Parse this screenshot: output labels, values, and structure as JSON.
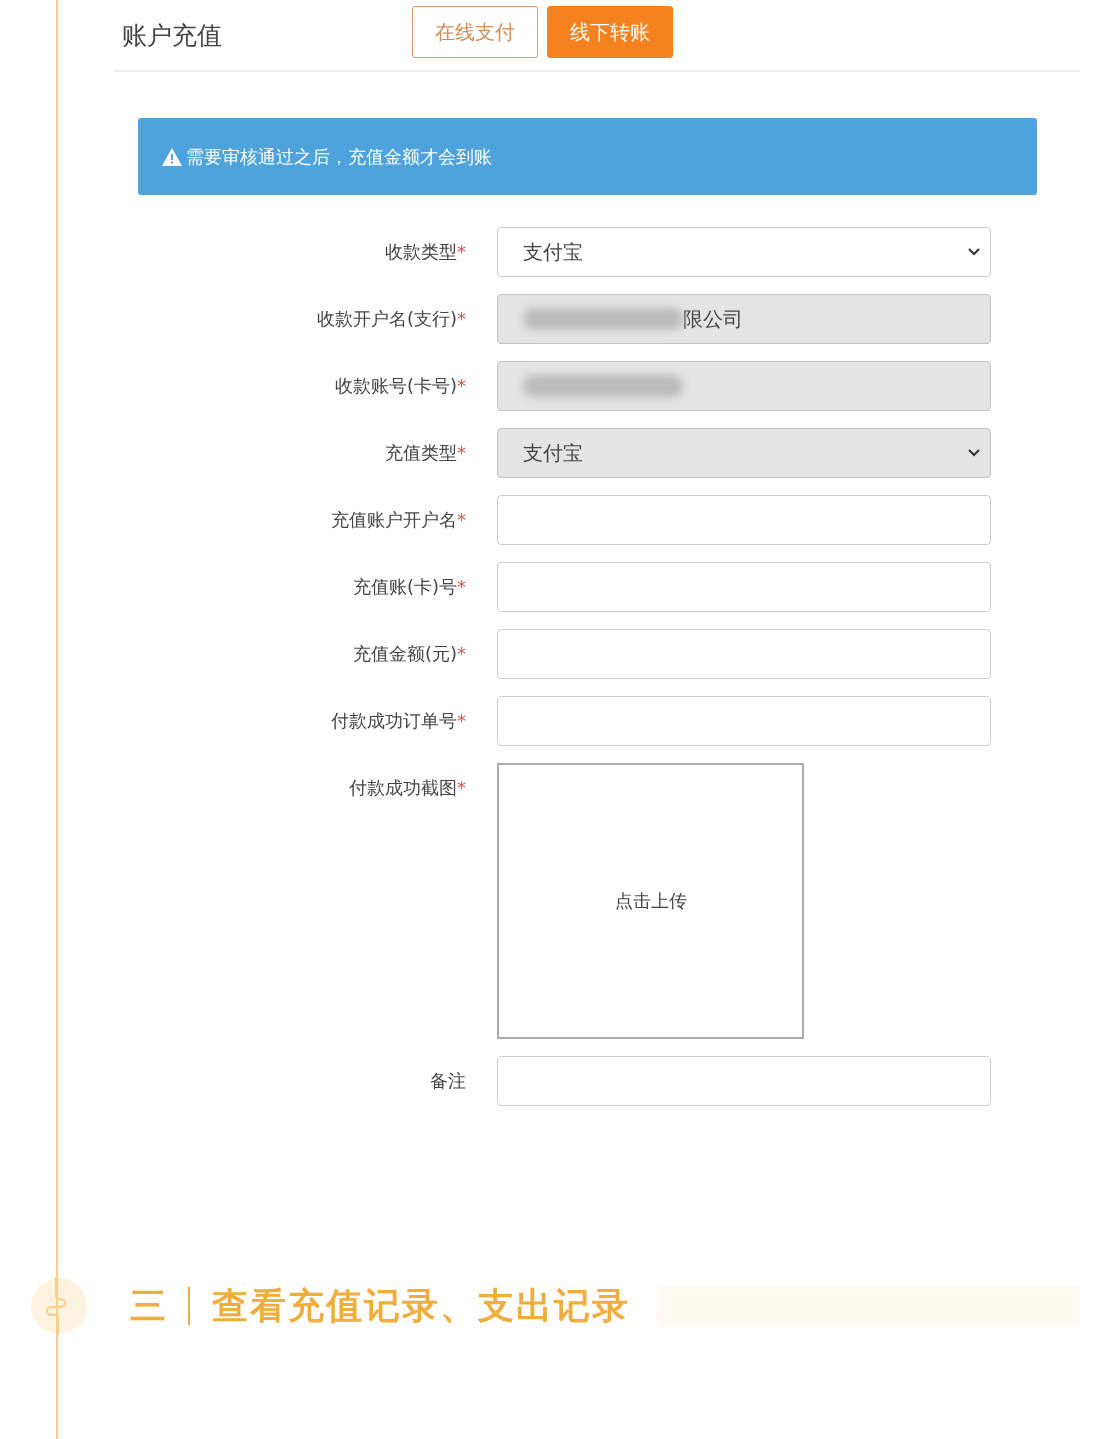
{
  "header": {
    "title": "账户充值",
    "tabs": [
      {
        "label": "在线支付",
        "selected": false
      },
      {
        "label": "线下转账",
        "selected": true
      }
    ]
  },
  "alert": {
    "text": "需要审核通过之后，充值金额才会到账"
  },
  "fields": [
    {
      "kind": "select",
      "label": "收款类型",
      "required_mark": "*",
      "value": "支付宝",
      "disabled": false
    },
    {
      "kind": "text",
      "label": "收款开户名(支行)",
      "required_mark": "*",
      "value": "限公司",
      "disabled": true,
      "blurred": true
    },
    {
      "kind": "text",
      "label": "收款账号(卡号)",
      "required_mark": "*",
      "disabled": true,
      "blurred": true
    },
    {
      "kind": "select",
      "label": "充值类型",
      "required_mark": "*",
      "value": "支付宝",
      "disabled": true
    },
    {
      "kind": "text",
      "label": "充值账户开户名",
      "required_mark": "*",
      "disabled": false
    },
    {
      "kind": "text",
      "label": "充值账(卡)号",
      "required_mark": "*",
      "disabled": false
    },
    {
      "kind": "text",
      "label": "充值金额(元)",
      "required_mark": "*",
      "disabled": false
    },
    {
      "kind": "text",
      "label": "付款成功订单号",
      "required_mark": "*",
      "disabled": false
    },
    {
      "kind": "upload",
      "label": "付款成功截图",
      "required_mark": "*",
      "value": "点击上传"
    },
    {
      "kind": "text",
      "label": "备注",
      "disabled": false
    }
  ],
  "section": {
    "number": "三",
    "title": "查看充值记录、支出记录"
  }
}
